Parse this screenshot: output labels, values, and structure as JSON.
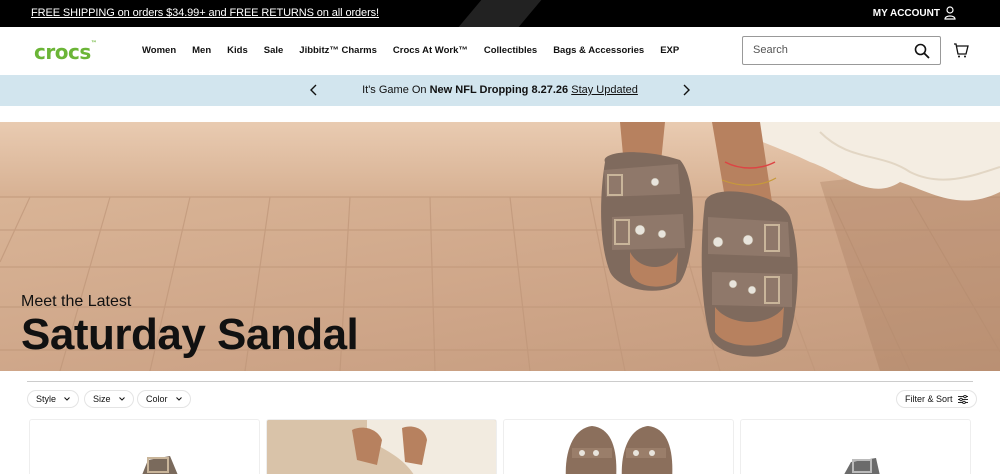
{
  "promo": {
    "text": "FREE SHIPPING on orders $34.99+ and FREE RETURNS on all orders!",
    "account_label": "MY ACCOUNT"
  },
  "header": {
    "logo_text": "crocs",
    "nav": [
      {
        "label": "Women"
      },
      {
        "label": "Men"
      },
      {
        "label": "Kids"
      },
      {
        "label": "Sale"
      },
      {
        "label": "Jibbitz™ Charms"
      },
      {
        "label": "Crocs At Work™"
      },
      {
        "label": "Collectibles"
      },
      {
        "label": "Bags & Accessories"
      },
      {
        "label": "EXP"
      }
    ],
    "search_placeholder": "Search"
  },
  "announcement": {
    "prefix": "It's Game On",
    "bold": "New NFL Dropping 8.27.26",
    "link": "Stay Updated"
  },
  "hero": {
    "eyebrow": "Meet the Latest",
    "headline": "Saturday Sandal"
  },
  "filters": {
    "style": "Style",
    "size": "Size",
    "color": "Color",
    "sort": "Filter & Sort"
  },
  "colors": {
    "promo_bg": "#000000",
    "logo_green": "#6bb537",
    "announce_bg": "#d2e5ee"
  },
  "icons": [
    "user-icon",
    "search-icon",
    "cart-icon",
    "chevron-left-icon",
    "chevron-right-icon",
    "chevron-down-icon",
    "sliders-icon"
  ]
}
